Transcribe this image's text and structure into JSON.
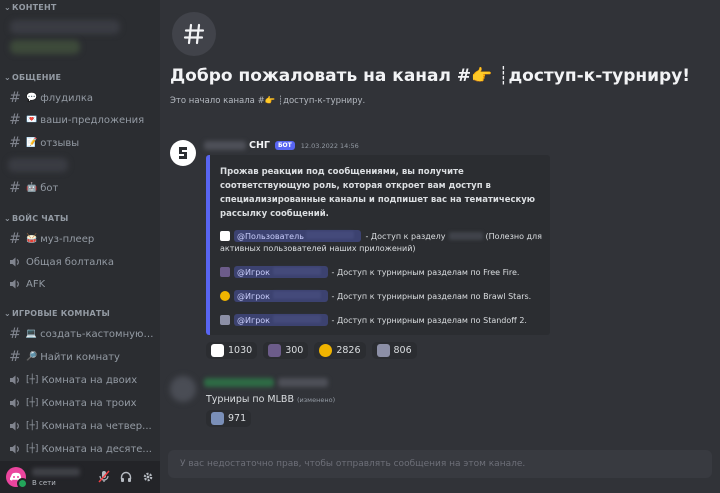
{
  "sidebar": {
    "categories": {
      "content": "КОНТЕНТ",
      "general": "ОБЩЕНИЕ",
      "voice": "ВОЙС ЧАТЫ",
      "game_rooms": "ИГРОВЫЕ КОМНАТЫ"
    },
    "channels": {
      "fludilka": "флудилка",
      "suggestions": "ваши-предложения",
      "reviews": "отзывы",
      "bot": "бот",
      "music": "муз-плеер",
      "general_talk": "Общая болталка",
      "afk": "AFK",
      "create_custom": "создать-кастомную-...",
      "find_room": "Найти комнату",
      "room_two": "Комната на двоих",
      "room_three": "Комната на троих",
      "room_four": "Комната на четвер...",
      "room_ten": "Комната на десяте..."
    },
    "user_status": "В сети"
  },
  "main": {
    "welcome_title": "Добро пожаловать на канал #👉 ┊доступ-к-турниру!",
    "welcome_sub": "Это начало канала #👉 ┊доступ-к-турниру.",
    "message1": {
      "author": "СНГ",
      "bot_tag": "БОТ",
      "timestamp": "12.03.2022 14:56",
      "embed_desc": "Прожав реакции под сообщениями, вы получите соответствующую роль, которая откроет вам доступ в специализированные каналы и подпишет вас на тематическую рассылку сообщений.",
      "rows": {
        "r1_mention": "@Пользователь",
        "r1_text": "- Доступ к разделу",
        "r1_text2": "(Полезно для",
        "r1_text3": "активных пользователей наших приложений)",
        "r2_mention": "@Игрок",
        "r2_text": "- Доступ к турнирным разделам по Free Fire.",
        "r3_mention": "@Игрок",
        "r3_text": "- Доступ к турнирным разделам по Brawl Stars.",
        "r4_mention": "@Игрок",
        "r4_text": "- Доступ к турнирным разделам по Standoff 2."
      },
      "reactions": [
        "1030",
        "300",
        "2826",
        "806"
      ]
    },
    "message2": {
      "text": "Турниры по MLBB",
      "edited": "(изменено)",
      "reaction": "971"
    },
    "input_placeholder": "У вас недостаточно прав, чтобы отправлять сообщения на этом канале."
  },
  "colors": {
    "background": "#313338",
    "sidebar": "#2b2d31",
    "accent": "#5865f2",
    "online": "#23a55a"
  }
}
